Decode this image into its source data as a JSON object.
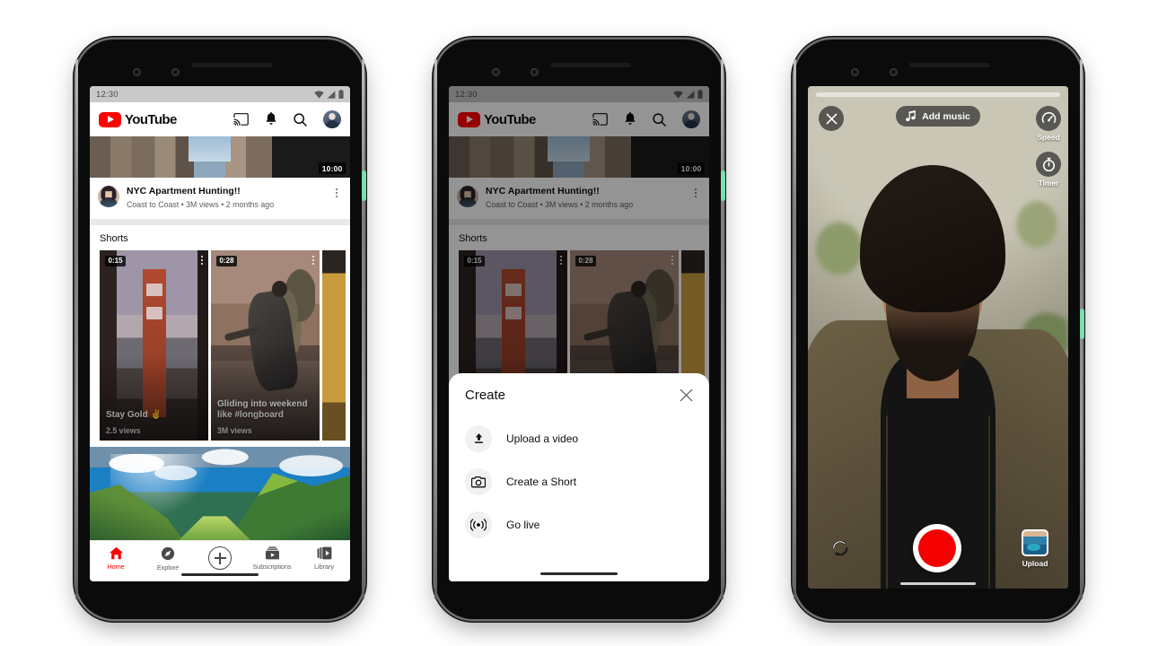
{
  "app": {
    "name": "YouTube"
  },
  "phones": [
    {
      "id": "phone-home",
      "label": "youtube-home-screen"
    },
    {
      "id": "phone-create",
      "label": "youtube-create-sheet-screen"
    },
    {
      "id": "phone-camera",
      "label": "youtube-shorts-camera-screen"
    }
  ],
  "status_bar": {
    "time": "12:30",
    "wifi_icon": "wifi-icon",
    "signal_icon": "signal-icon",
    "battery_icon": "battery-icon"
  },
  "header": {
    "logo_text": "YouTube",
    "logo_color": "#FF0000",
    "actions": [
      {
        "name": "cast-icon",
        "label": "Cast"
      },
      {
        "name": "notifications-bell-icon",
        "label": "Notifications"
      },
      {
        "name": "search-icon",
        "label": "Search"
      },
      {
        "name": "account-avatar",
        "label": "Account"
      }
    ]
  },
  "feed_video": {
    "duration": "10:00",
    "title": "NYC Apartment Hunting!!",
    "meta": "Coast to Coast • 3M views • 2 months ago",
    "channel": "Coast to Coast",
    "views": "3M views",
    "age": "2 months ago",
    "menu_icon": "kebab-menu-icon"
  },
  "shorts": {
    "section_title": "Shorts",
    "items": [
      {
        "duration": "0:15",
        "caption": "Stay Gold ✌",
        "views": "2.5 views",
        "art": "golden-gate-bridge"
      },
      {
        "duration": "0:28",
        "caption": "Gliding into weekend like #longboard",
        "views": "3M views",
        "art": "longboarder"
      },
      {
        "duration": "",
        "caption": "",
        "views": "",
        "art": "partial-gold"
      }
    ]
  },
  "bottom_nav": {
    "active_color": "#FF0000",
    "items": [
      {
        "label": "Home",
        "icon": "home-icon",
        "active": true
      },
      {
        "label": "Explore",
        "icon": "compass-icon",
        "active": false
      },
      {
        "label": "",
        "icon": "create-plus-icon",
        "active": false
      },
      {
        "label": "Subscriptions",
        "icon": "subscriptions-icon",
        "active": false
      },
      {
        "label": "Library",
        "icon": "library-icon",
        "active": false
      }
    ]
  },
  "create_sheet": {
    "title": "Create",
    "close_icon": "close-x-icon",
    "options": [
      {
        "label": "Upload a video",
        "icon": "upload-arrow-icon"
      },
      {
        "label": "Create a Short",
        "icon": "camera-icon"
      },
      {
        "label": "Go live",
        "icon": "broadcast-live-icon"
      }
    ]
  },
  "camera": {
    "close_icon": "close-x-icon",
    "music_button": {
      "label": "Add music",
      "icon": "music-note-icon"
    },
    "tools": [
      {
        "label": "Speed",
        "icon": "speedometer-icon"
      },
      {
        "label": "Timer",
        "icon": "stopwatch-icon"
      }
    ],
    "flip_icon": "flip-camera-icon",
    "record_button": {
      "name": "record-button",
      "color": "#F40000"
    },
    "upload": {
      "label": "Upload",
      "icon": "gallery-thumbnail"
    },
    "progress_bar": "recording-progress-bar"
  }
}
